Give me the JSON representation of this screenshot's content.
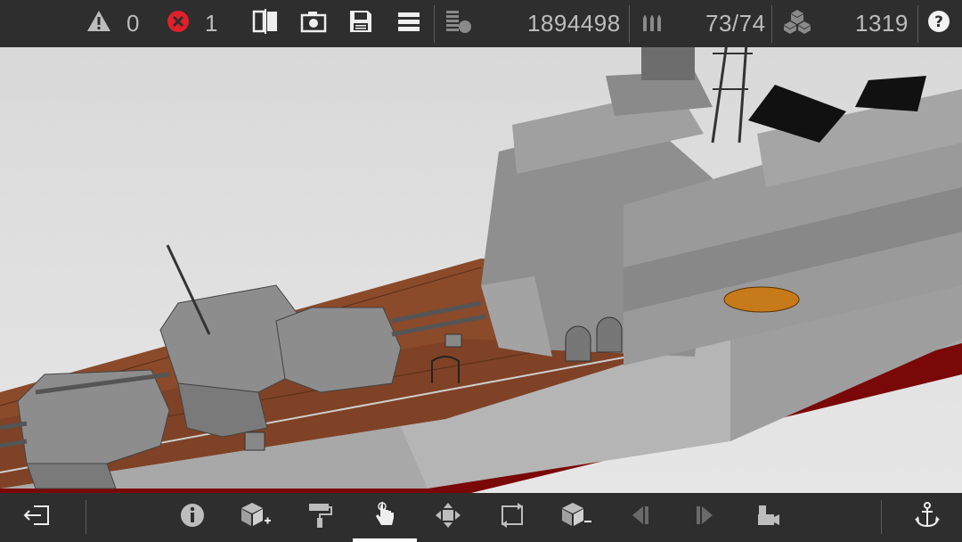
{
  "status": {
    "warnings_count": "0",
    "errors_count": "1",
    "polygon_count": "1894498",
    "ammo_count": "73/74",
    "blocks_count": "1319"
  },
  "colors": {
    "bar_bg": "#2e2e2e",
    "icon": "#e8e8e8",
    "text": "#bdbdbd",
    "error_red": "#e0202a",
    "hull_red": "#8a0a0a",
    "deck_wood": "#8b4a2a",
    "hull_gray": "#9a9a9a"
  },
  "toolbar_top_icons": [
    "warning-icon",
    "error-icon",
    "split-view-icon",
    "camera-icon",
    "save-icon",
    "menu-icon",
    "polygon-count-icon",
    "ammo-icon",
    "blocks-icon",
    "help-icon"
  ],
  "toolbar_bottom_icons": [
    "exit-icon",
    "info-icon",
    "add-block-icon",
    "paint-roller-icon",
    "touch-select-icon",
    "move-icon",
    "rotate-icon",
    "remove-block-icon",
    "undo-icon",
    "redo-icon",
    "camera-view-icon",
    "anchor-icon"
  ],
  "active_tool": "touch-select-icon"
}
